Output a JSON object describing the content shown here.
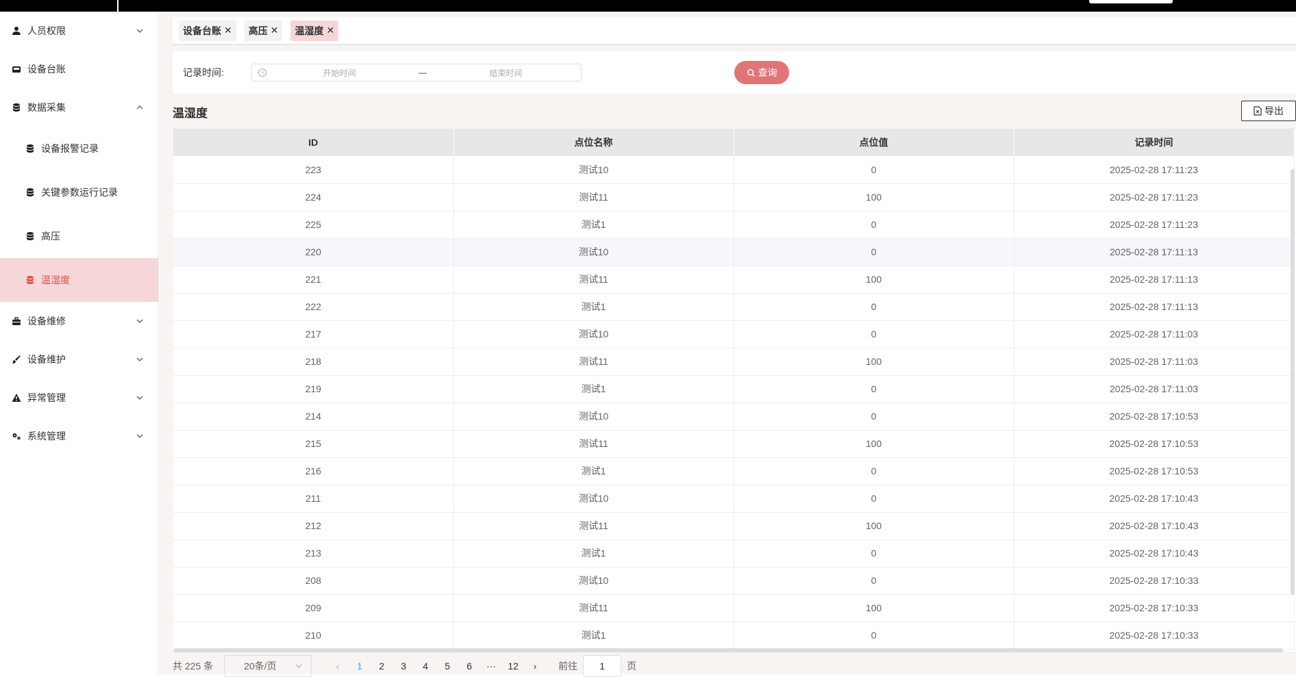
{
  "sidebar": {
    "items": [
      {
        "label": "人员权限",
        "icon": "user-icon",
        "expanded": false
      },
      {
        "label": "设备台账",
        "icon": "inbox-icon"
      },
      {
        "label": "数据采集",
        "icon": "database-icon",
        "expanded": true,
        "children": [
          {
            "label": "设备报警记录",
            "icon": "database-icon"
          },
          {
            "label": "关键参数运行记录",
            "icon": "database-icon"
          },
          {
            "label": "高压",
            "icon": "database-icon"
          },
          {
            "label": "温湿度",
            "icon": "database-icon",
            "active": true
          }
        ]
      },
      {
        "label": "设备维修",
        "icon": "toolbox-icon",
        "expanded": false
      },
      {
        "label": "设备维护",
        "icon": "brush-icon",
        "expanded": false
      },
      {
        "label": "异常管理",
        "icon": "warning-icon",
        "expanded": false
      },
      {
        "label": "系统管理",
        "icon": "gears-icon",
        "expanded": false
      }
    ]
  },
  "tabs": [
    {
      "label": "设备台账",
      "close": "✕"
    },
    {
      "label": "高压",
      "close": "✕"
    },
    {
      "label": "温湿度",
      "close": "✕",
      "active": true
    }
  ],
  "filter": {
    "label": "记录时间:",
    "start_placeholder": "开始时间",
    "separator": "—",
    "end_placeholder": "结束时间",
    "query_label": "查询"
  },
  "section": {
    "title": "温湿度",
    "export_label": "导出"
  },
  "table": {
    "columns": [
      "ID",
      "点位名称",
      "点位值",
      "记录时间"
    ],
    "rows": [
      [
        "223",
        "测试10",
        "0",
        "2025-02-28 17:11:23"
      ],
      [
        "224",
        "测试11",
        "100",
        "2025-02-28 17:11:23"
      ],
      [
        "225",
        "测试1",
        "0",
        "2025-02-28 17:11:23"
      ],
      [
        "220",
        "测试10",
        "0",
        "2025-02-28 17:11:13"
      ],
      [
        "221",
        "测试11",
        "100",
        "2025-02-28 17:11:13"
      ],
      [
        "222",
        "测试1",
        "0",
        "2025-02-28 17:11:13"
      ],
      [
        "217",
        "测试10",
        "0",
        "2025-02-28 17:11:03"
      ],
      [
        "218",
        "测试11",
        "100",
        "2025-02-28 17:11:03"
      ],
      [
        "219",
        "测试1",
        "0",
        "2025-02-28 17:11:03"
      ],
      [
        "214",
        "测试10",
        "0",
        "2025-02-28 17:10:53"
      ],
      [
        "215",
        "测试11",
        "100",
        "2025-02-28 17:10:53"
      ],
      [
        "216",
        "测试1",
        "0",
        "2025-02-28 17:10:53"
      ],
      [
        "211",
        "测试10",
        "0",
        "2025-02-28 17:10:43"
      ],
      [
        "212",
        "测试11",
        "100",
        "2025-02-28 17:10:43"
      ],
      [
        "213",
        "测试1",
        "0",
        "2025-02-28 17:10:43"
      ],
      [
        "208",
        "测试10",
        "0",
        "2025-02-28 17:10:33"
      ],
      [
        "209",
        "测试11",
        "100",
        "2025-02-28 17:10:33"
      ],
      [
        "210",
        "测试1",
        "0",
        "2025-02-28 17:10:33"
      ]
    ]
  },
  "pagination": {
    "total_text": "共 225 条",
    "page_size": "20条/页",
    "prev": "‹",
    "pages": [
      "1",
      "2",
      "3",
      "4",
      "5",
      "6",
      "···",
      "12"
    ],
    "current": "1",
    "next": "›",
    "goto_prefix": "前往",
    "goto_value": "1",
    "goto_suffix": "页"
  },
  "colors": {
    "accent": "#e07476",
    "active_bg": "#f5d7d9",
    "active_text": "#d9534f",
    "page_active": "#409eff"
  }
}
